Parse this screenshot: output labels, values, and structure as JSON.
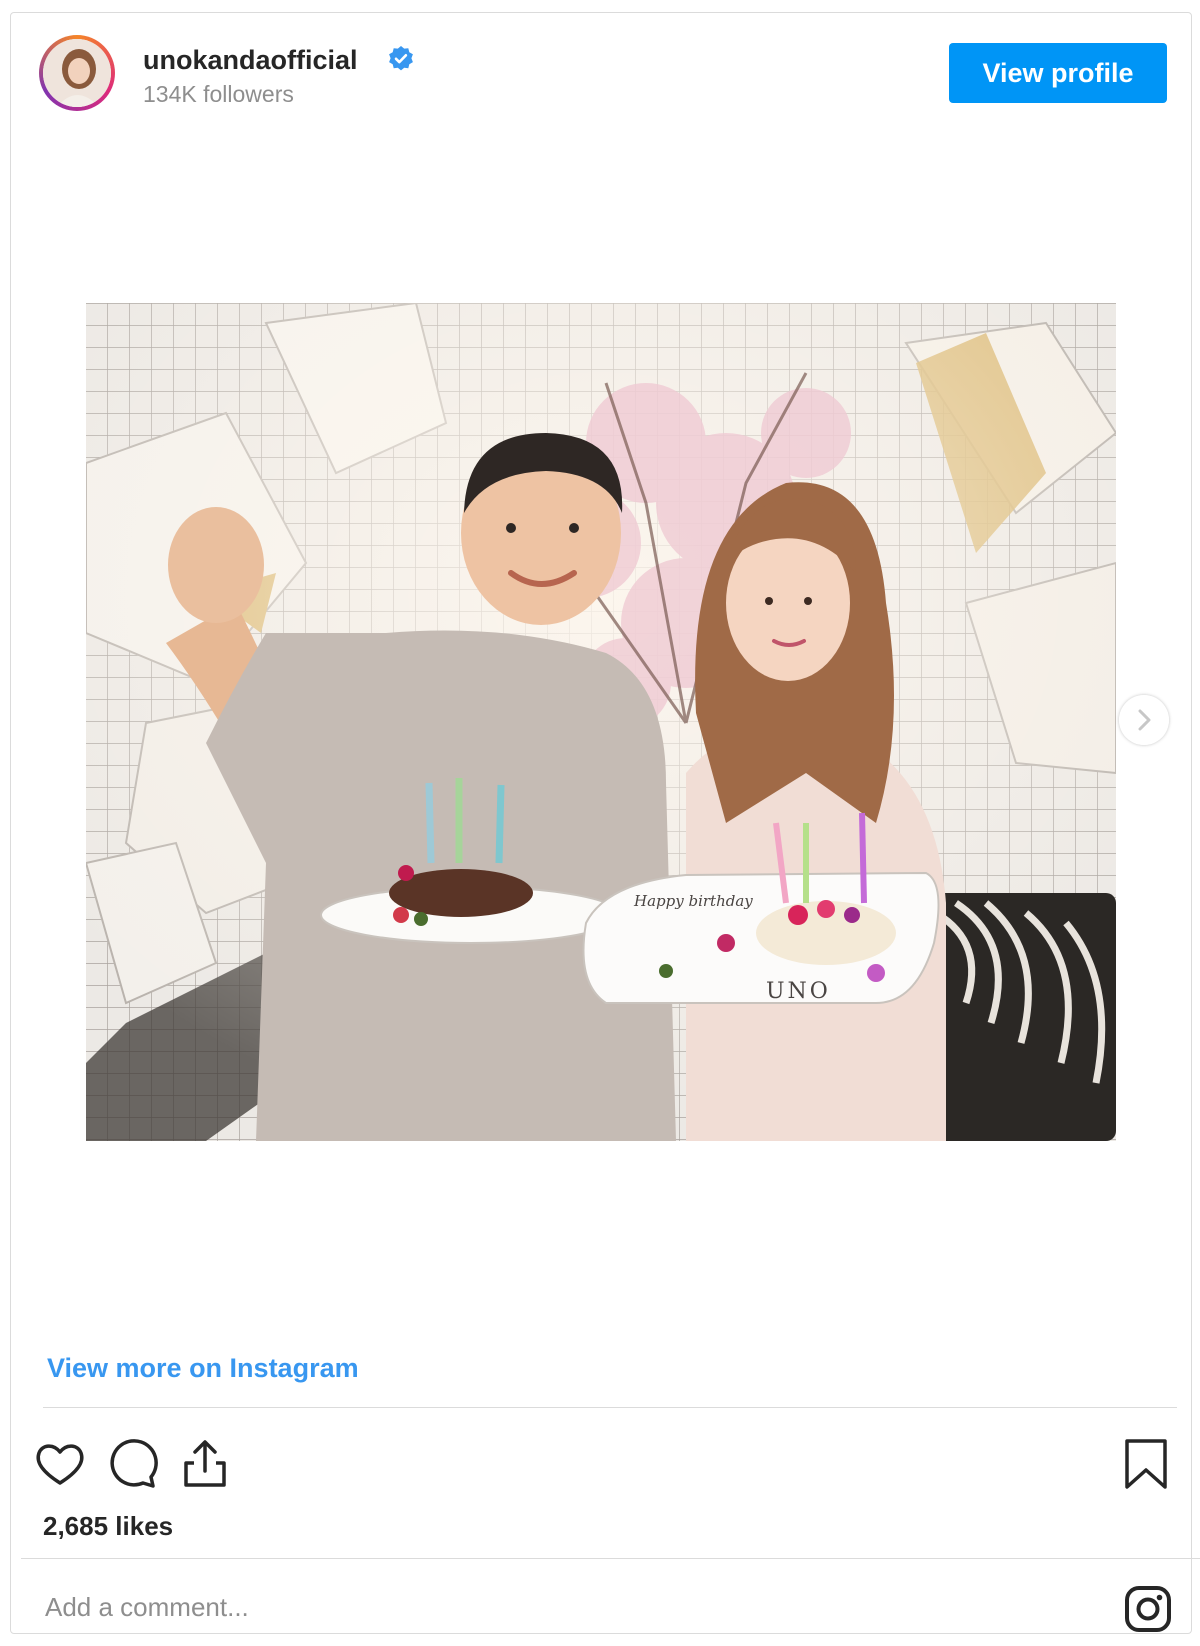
{
  "header": {
    "username": "unokandaofficial",
    "followers": "134K followers",
    "view_profile_label": "View profile"
  },
  "post": {
    "plate_text_1": "Happy birthday",
    "plate_text_2": "UNO"
  },
  "links": {
    "view_more": "View more on Instagram"
  },
  "stats": {
    "likes": "2,685 likes"
  },
  "comment": {
    "placeholder": "Add a comment..."
  },
  "icons": {
    "verified": "verified-badge-icon",
    "next": "chevron-right-icon",
    "like": "heart-icon",
    "comment": "comment-bubble-icon",
    "share": "share-icon",
    "save": "bookmark-icon",
    "logo": "instagram-logo-icon"
  },
  "colors": {
    "accent": "#0095f6",
    "link": "#3897f0",
    "muted": "#8e8e8e",
    "text": "#262626"
  }
}
